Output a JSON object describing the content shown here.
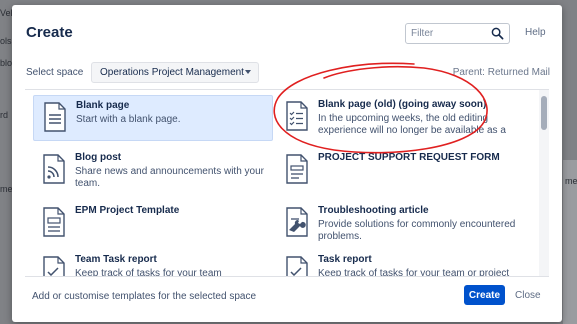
{
  "background": {
    "left_fragments": [
      "Vel",
      "ols",
      "blo",
      "rd",
      "me"
    ],
    "right_fragment": "me"
  },
  "dialog": {
    "title": "Create",
    "filter_placeholder": "Filter",
    "help_label": "Help",
    "space_label": "Select space",
    "space_value": "Operations Project Management",
    "parent_label": "Parent: Returned Mail",
    "footer_link": "Add or customise templates for the selected space",
    "create_label": "Create",
    "close_label": "Close"
  },
  "templates": [
    {
      "name": "Blank page",
      "description": "Start with a blank page.",
      "icon": "blank-page-icon",
      "selected": true
    },
    {
      "name": "Blank page (old) (going away soon)",
      "description": "In the upcoming weeks, the old editing experience will no longer be available as a",
      "icon": "checklist-page-icon"
    },
    {
      "name": "Blog post",
      "description": "Share news and announcements with your team.",
      "icon": "blog-post-icon"
    },
    {
      "name": "PROJECT SUPPORT REQUEST FORM",
      "description": "",
      "icon": "page-icon"
    },
    {
      "name": "EPM Project Template",
      "description": "",
      "icon": "project-template-icon"
    },
    {
      "name": "Troubleshooting article",
      "description": "Provide solutions for commonly encountered problems.",
      "icon": "troubleshooting-icon"
    },
    {
      "name": "Team Task report",
      "description": "Keep track of tasks for your team",
      "icon": "task-report-icon"
    },
    {
      "name": "Task report",
      "description": "Keep track of tasks for your team or project",
      "icon": "task-report-icon"
    }
  ],
  "colors": {
    "accent": "#0052cc",
    "selected_bg": "#deebff",
    "annotation": "#e02020"
  }
}
